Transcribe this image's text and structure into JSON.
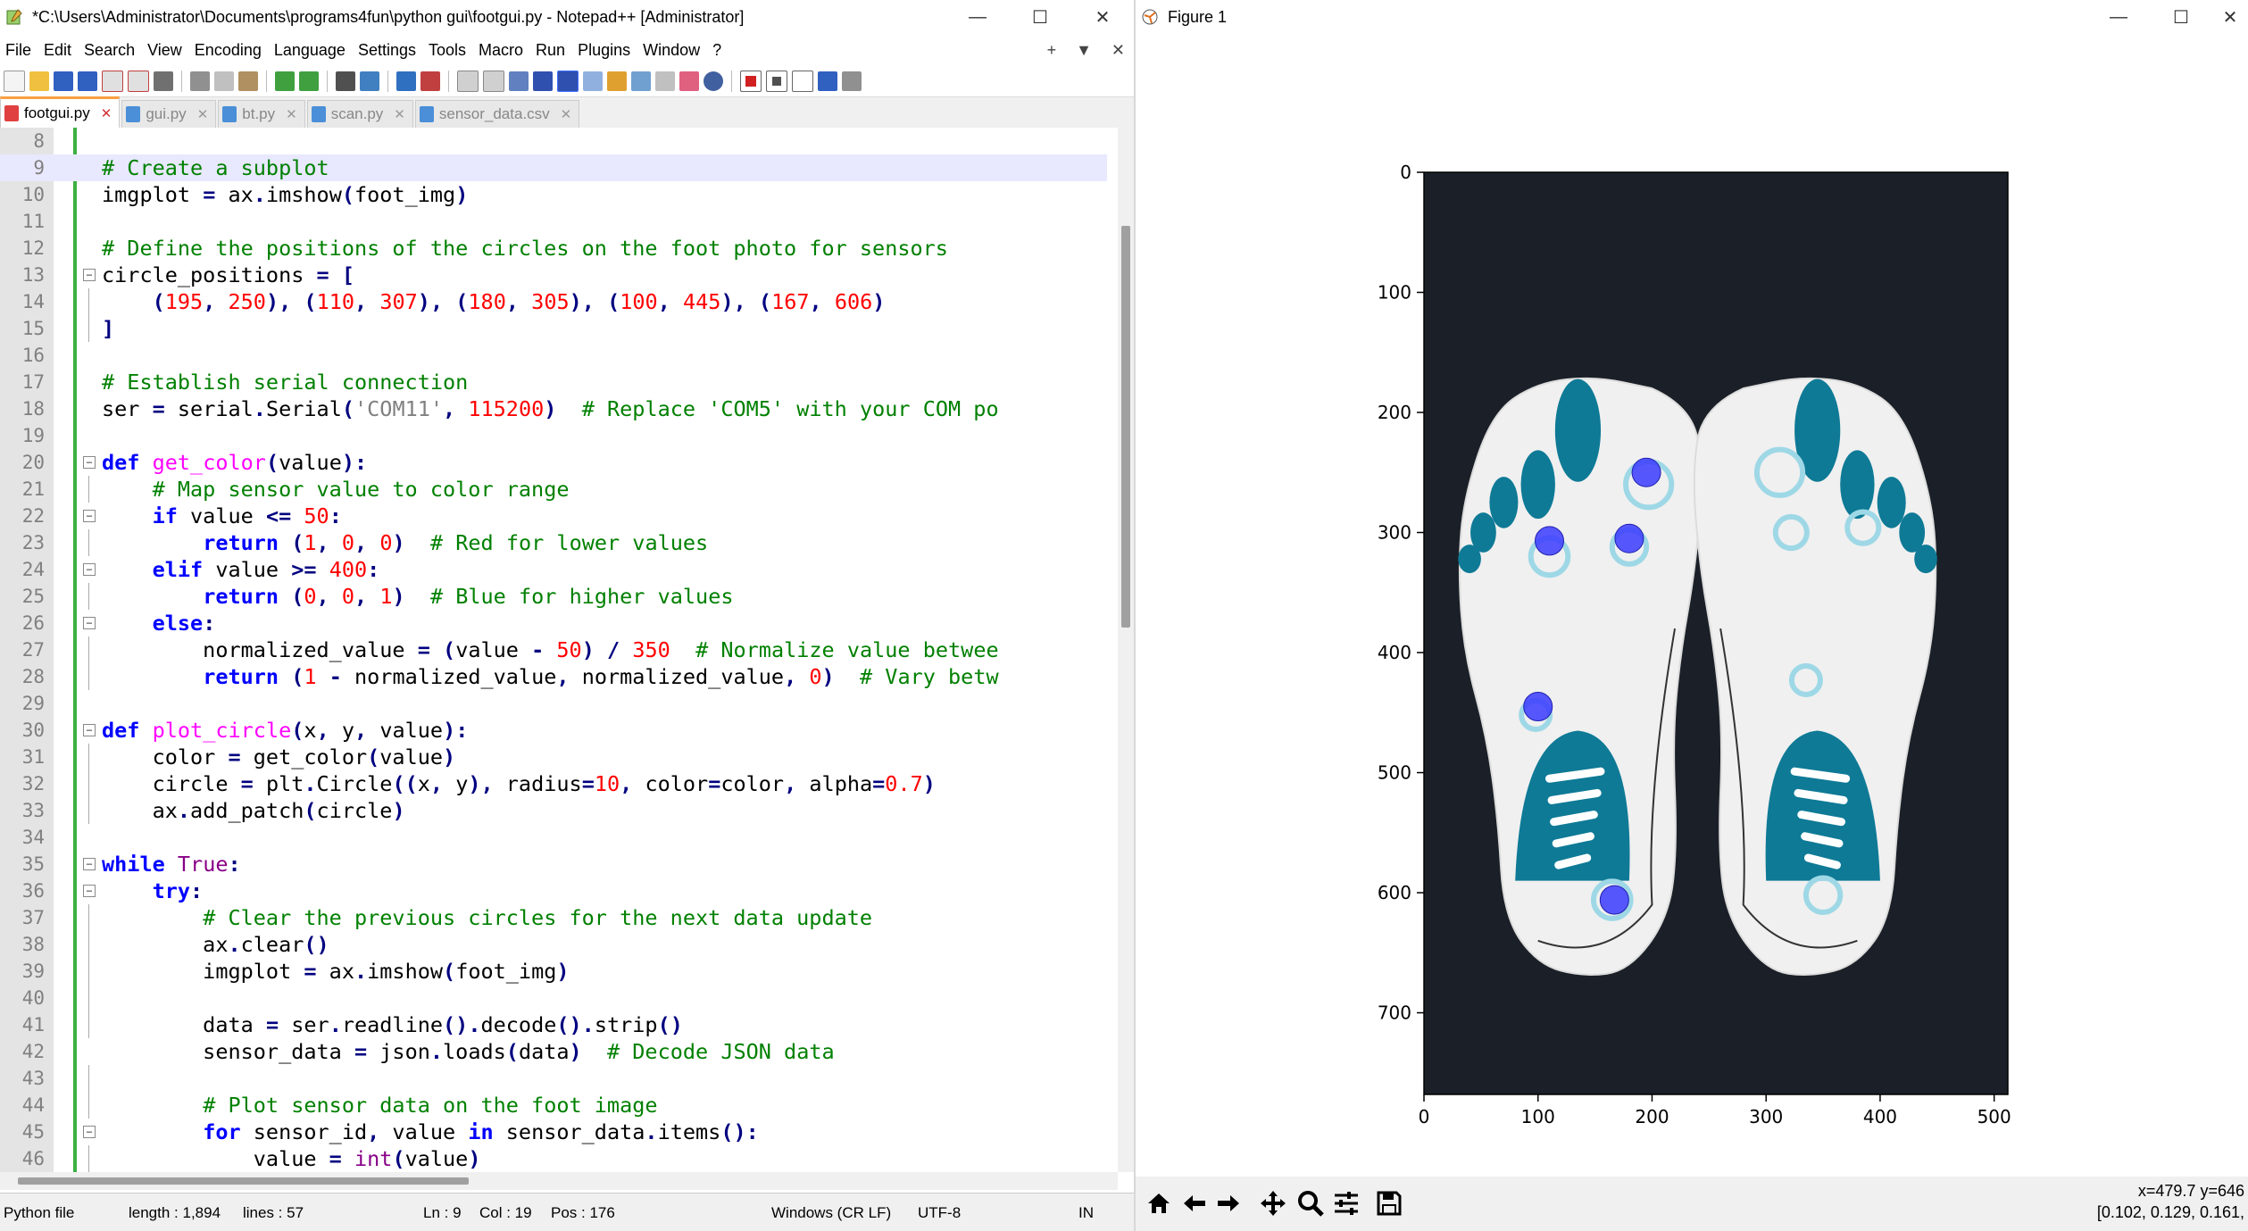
{
  "notepad": {
    "title": "*C:\\Users\\Administrator\\Documents\\programs4fun\\python gui\\footgui.py - Notepad++ [Administrator]",
    "menus": [
      "File",
      "Edit",
      "Search",
      "View",
      "Encoding",
      "Language",
      "Settings",
      "Tools",
      "Macro",
      "Run",
      "Plugins",
      "Window",
      "?"
    ],
    "menu_right": [
      "+",
      "▼",
      "✕"
    ],
    "tabs": [
      {
        "label": "footgui.py",
        "active": true
      },
      {
        "label": "gui.py",
        "active": false
      },
      {
        "label": "bt.py",
        "active": false
      },
      {
        "label": "scan.py",
        "active": false
      },
      {
        "label": "sensor_data.csv",
        "active": false
      }
    ],
    "status": {
      "type": "Python file",
      "length": "length : 1,894",
      "lines": "lines : 57",
      "ln": "Ln : 9",
      "col": "Col : 19",
      "pos": "Pos : 176",
      "eol": "Windows (CR LF)",
      "enc": "UTF-8",
      "ins": "IN"
    },
    "line_numbers": [
      "8",
      "9",
      "10",
      "11",
      "12",
      "13",
      "14",
      "15",
      "16",
      "17",
      "18",
      "19",
      "20",
      "21",
      "22",
      "23",
      "24",
      "25",
      "26",
      "27",
      "28",
      "29",
      "30",
      "31",
      "32",
      "33",
      "34",
      "35",
      "36",
      "37",
      "38",
      "39",
      "40",
      "41",
      "42",
      "43",
      "44",
      "45",
      "46"
    ],
    "code": [
      "",
      "# Create a subplot",
      "imgplot = ax.imshow(foot_img)",
      "",
      "# Define the positions of the circles on the foot photo for sensors",
      "circle_positions = [",
      "    (195, 250), (110, 307), (180, 305), (100, 445), (167, 606)",
      "]",
      "",
      "# Establish serial connection",
      "ser = serial.Serial('COM11', 115200)  # Replace 'COM5' with your COM po",
      "",
      "def get_color(value):",
      "    # Map sensor value to color range",
      "    if value <= 50:",
      "        return (1, 0, 0)  # Red for lower values",
      "    elif value >= 400:",
      "        return (0, 0, 1)  # Blue for higher values",
      "    else:",
      "        normalized_value = (value - 50) / 350  # Normalize value betwee",
      "        return (1 - normalized_value, normalized_value, 0)  # Vary betw",
      "",
      "def plot_circle(x, y, value):",
      "    color = get_color(value)",
      "    circle = plt.Circle((x, y), radius=10, color=color, alpha=0.7)",
      "    ax.add_patch(circle)",
      "",
      "while True:",
      "    try:",
      "        # Clear the previous circles for the next data update",
      "        ax.clear()",
      "        imgplot = ax.imshow(foot_img)",
      "",
      "        data = ser.readline().decode().strip()",
      "        sensor_data = json.loads(data)  # Decode JSON data",
      "",
      "        # Plot sensor data on the foot image",
      "        for sensor_id, value in sensor_data.items():",
      "            value = int(value)"
    ]
  },
  "figure": {
    "title": "Figure 1",
    "coords_line1": "x=479.7 y=646",
    "coords_line2": "[0.102, 0.129, 0.161,",
    "toolbar": [
      "home-icon",
      "back-icon",
      "forward-icon",
      "pan-icon",
      "zoom-icon",
      "configure-icon",
      "save-icon"
    ]
  },
  "chart_data": {
    "type": "scatter",
    "title": "",
    "xlabel": "",
    "ylabel": "",
    "xlim": [
      0,
      512
    ],
    "ylim": [
      768,
      0
    ],
    "x_ticks": [
      "0",
      "100",
      "200",
      "300",
      "400",
      "500"
    ],
    "y_ticks": [
      "0",
      "100",
      "200",
      "300",
      "400",
      "500",
      "600",
      "700"
    ],
    "background_image": "foot insole image (dark background, two insoles)",
    "series": [
      {
        "values": [
          [
            195,
            250
          ],
          [
            110,
            307
          ],
          [
            180,
            305
          ],
          [
            100,
            445
          ],
          [
            167,
            606
          ]
        ]
      }
    ],
    "point_color": "#3b3bff",
    "colors": {
      "image_bg": "#1b2028",
      "insole": "#f0f0f0",
      "pad": "#0e7a96",
      "ring": "#9ed8e6"
    }
  }
}
